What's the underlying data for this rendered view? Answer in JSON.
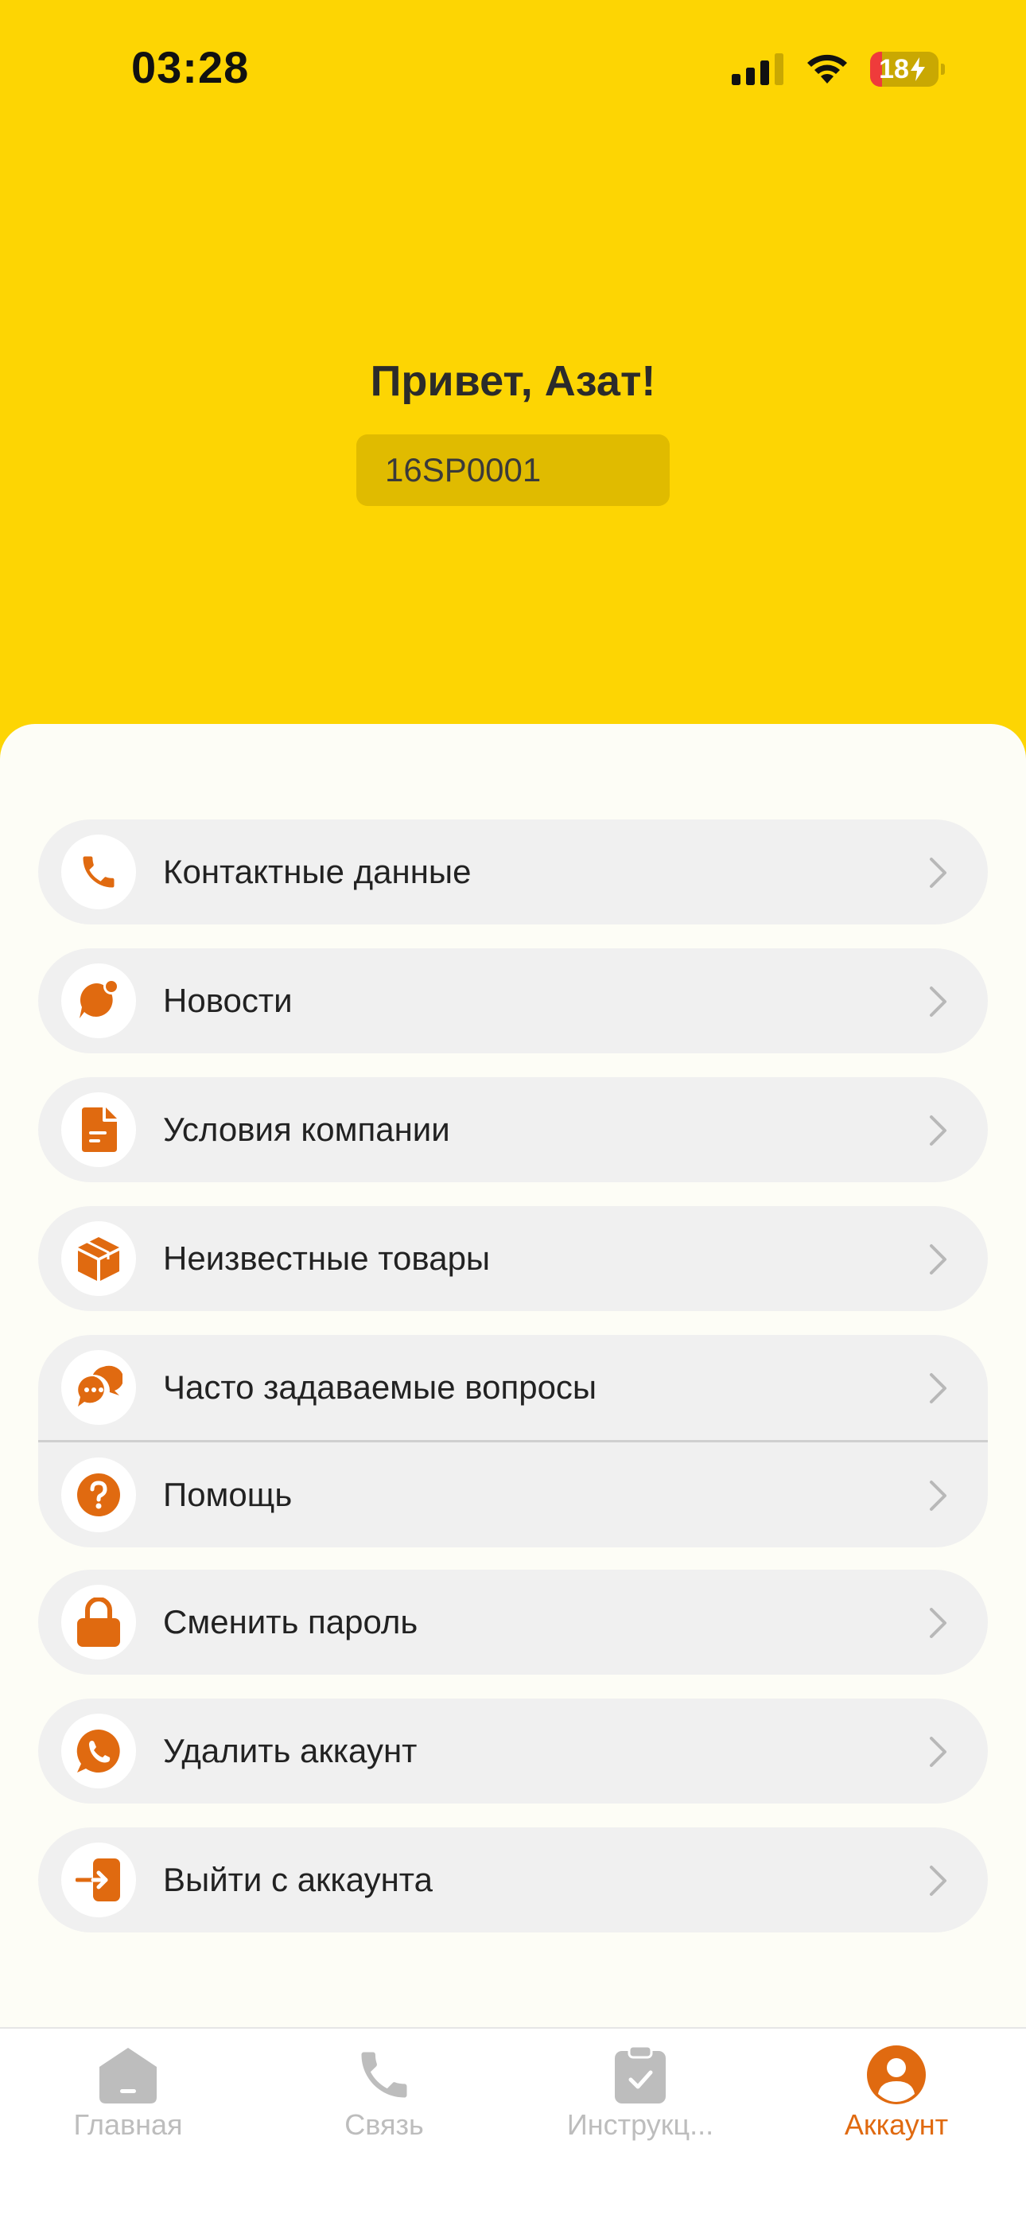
{
  "status_bar": {
    "time": "03:28",
    "battery_level": "18",
    "battery_fraction": 0.18
  },
  "header": {
    "greeting": "Привет, Азат!",
    "user_code": "16SP0001",
    "background_color": "#FDD503"
  },
  "accent_color": "#E06A10",
  "menu": {
    "contacts": {
      "label": "Контактные данные",
      "icon": "phone-icon"
    },
    "news": {
      "label": "Новости",
      "icon": "chat-bubble-notification-icon"
    },
    "terms": {
      "label": "Условия компании",
      "icon": "document-icon"
    },
    "unknown_goods": {
      "label": "Неизвестные товары",
      "icon": "package-icon"
    },
    "faq": {
      "label": "Часто задаваемые вопросы",
      "icon": "chat-bubbles-icon"
    },
    "help": {
      "label": "Помощь",
      "icon": "question-icon"
    },
    "change_password": {
      "label": "Сменить пароль",
      "icon": "lock-icon"
    },
    "delete_account": {
      "label": "Удалить аккаунт",
      "icon": "whatsapp-icon"
    },
    "logout": {
      "label": "Выйти с аккаунта",
      "icon": "logout-icon"
    }
  },
  "tabbar": {
    "home": {
      "label": "Главная",
      "icon": "home-icon",
      "active": false
    },
    "contact": {
      "label": "Связь",
      "icon": "phone-icon",
      "active": false
    },
    "instructions": {
      "label": "Инструкц...",
      "icon": "clipboard-icon",
      "active": false
    },
    "account": {
      "label": "Аккаунт",
      "icon": "user-icon",
      "active": true
    }
  }
}
